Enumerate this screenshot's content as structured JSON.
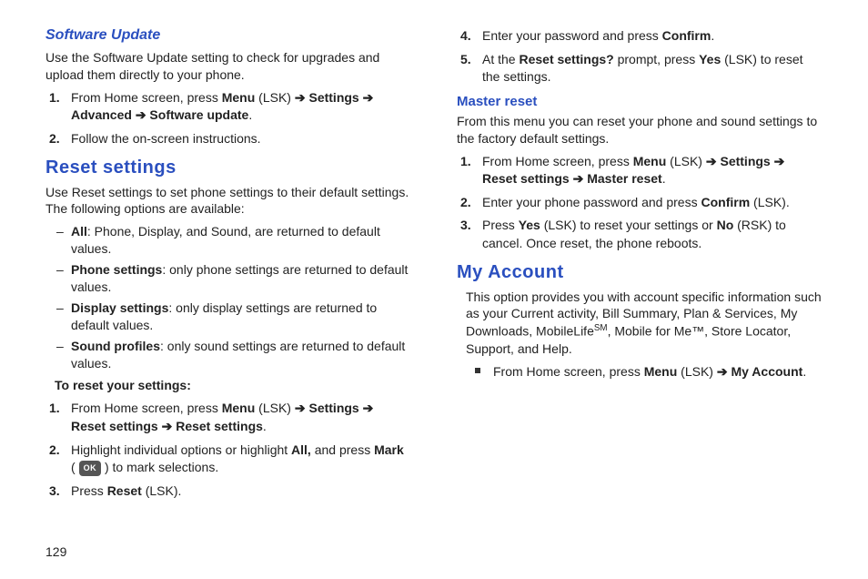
{
  "pageNumber": "129",
  "left": {
    "softwareUpdate": {
      "heading": "Software Update",
      "intro": "Use the Software Update setting to check for upgrades and upload them directly to your phone.",
      "steps": {
        "s1_a": "From Home screen, press ",
        "s1_b": "Menu",
        "s1_c": " (LSK) ",
        "s1_arrow1": "➔",
        "s1_d": " Settings ",
        "s1_arrow2": "➔",
        "s1_e": " Advanced  ",
        "s1_arrow3": "➔",
        "s1_f": " Software update",
        "s1_g": ".",
        "s2": "Follow the on-screen instructions."
      }
    },
    "resetSettings": {
      "heading": "Reset settings",
      "intro": "Use Reset settings to set phone settings to their default settings. The following options are available:",
      "opts": {
        "all_b": "All",
        "all_t": ": Phone, Display, and Sound, are returned to default values.",
        "phone_b": "Phone settings",
        "phone_t": ": only phone settings are returned to default values.",
        "display_b": "Display settings",
        "display_t": ": only display settings are returned to default values.",
        "sound_b": "Sound profiles",
        "sound_t": ": only sound settings are returned to default values."
      },
      "subhead": "To reset your settings:",
      "steps": {
        "s1_a": "From Home screen, press ",
        "s1_b": "Menu",
        "s1_c": " (LSK) ",
        "s1_ar1": "➔",
        "s1_d": " Settings ",
        "s1_ar2": "➔",
        "s1_e": " Reset settings ",
        "s1_ar3": "➔",
        "s1_f": " Reset settings",
        "s1_g": ".",
        "s2_a": "Highlight individual options or highlight ",
        "s2_b": "All,",
        "s2_c": " and press ",
        "s2_d": "Mark",
        "s2_e": " ( ",
        "s2_ok": "OK",
        "s2_f": " ) to mark selections.",
        "s3_a": "Press ",
        "s3_b": "Reset",
        "s3_c": " (LSK)."
      }
    }
  },
  "right": {
    "contSteps": {
      "s4_a": "Enter your password and press ",
      "s4_b": "Confirm",
      "s4_c": ".",
      "s5_a": "At the ",
      "s5_b": "Reset settings?",
      "s5_c": " prompt, press ",
      "s5_d": "Yes",
      "s5_e": " (LSK) to reset the settings."
    },
    "masterReset": {
      "heading": "Master reset",
      "intro": "From this menu you can reset your phone and sound settings to the factory default settings.",
      "steps": {
        "s1_a": "From Home screen, press ",
        "s1_b": "Menu",
        "s1_c": " (LSK) ",
        "s1_ar1": "➔",
        "s1_d": " Settings ",
        "s1_ar2": "➔",
        "s1_e": " Reset settings ",
        "s1_ar3": "➔",
        "s1_f": " Master reset",
        "s1_g": ".",
        "s2_a": "Enter your phone password and press ",
        "s2_b": "Confirm",
        "s2_c": " (LSK).",
        "s3_a": "Press ",
        "s3_b": "Yes",
        "s3_c": " (LSK) to reset your settings or ",
        "s3_d": "No",
        "s3_e": " (RSK) to cancel. Once reset, the phone reboots."
      }
    },
    "myAccount": {
      "heading": "My Account",
      "intro_a": "This option provides you with account specific information such as your Current activity, Bill Summary, Plan & Services, My Downloads, MobileLife",
      "intro_sm": "SM",
      "intro_b": ", Mobile for Me™, Store Locator, Support, and Help.",
      "step_a": "From Home screen, press ",
      "step_b": "Menu",
      "step_c": " (LSK) ",
      "step_ar": "➔",
      "step_d": " My Account",
      "step_e": "."
    }
  }
}
